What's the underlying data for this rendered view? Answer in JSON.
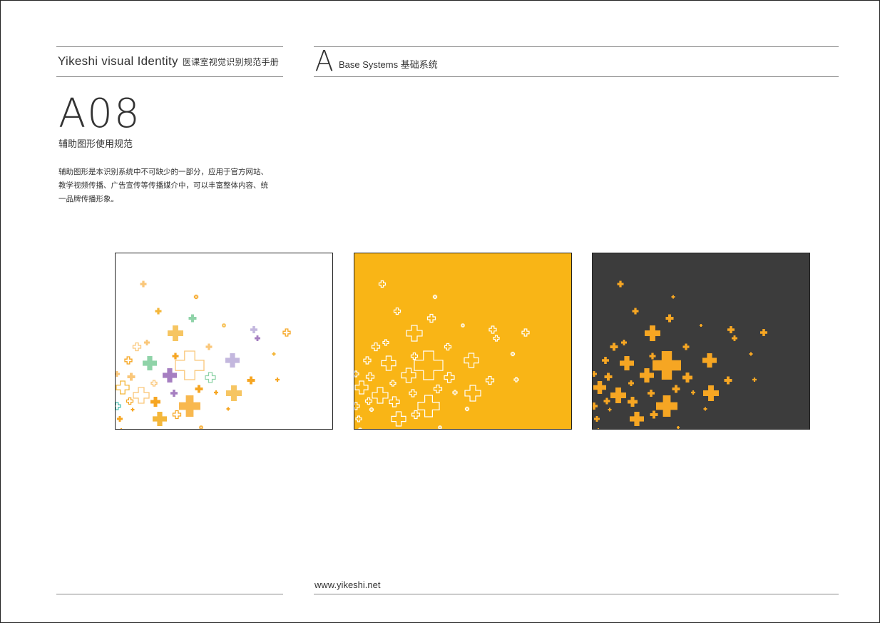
{
  "header": {
    "brand": "Yikeshi visual Identity",
    "brand_sub": "医课室视觉识别规范手册",
    "section_letter": "A",
    "section_title": "Base Systems 基础系统"
  },
  "content": {
    "code": "A08",
    "title": "辅助图形使用规范",
    "description": "辅助图形是本识别系统中不可缺少的一部分，应用于官方网站、教学视频传播、广告宣传等传播媒介中，可以丰富整体内容、统一品牌传播形象。"
  },
  "panels": [
    {
      "name": "white-background-sample",
      "background": "#ffffff",
      "border": "#222222",
      "style": "mixed"
    },
    {
      "name": "yellow-background-sample",
      "background": "#f9b516",
      "border": "#222222",
      "style": "outline"
    },
    {
      "name": "dark-background-sample",
      "background": "#3c3c3c",
      "border": "#222222",
      "style": "solid"
    }
  ],
  "colors": {
    "orange": "#f6a623",
    "light_orange": "#fac77a",
    "yellow": "#f4b73b",
    "green": "#8fd3a8",
    "purple": "#a67fc1",
    "lavender": "#c3b7de",
    "teal": "#4fc1b4",
    "white": "#ffffff"
  },
  "footer": {
    "url": "www.yikeshi.net"
  }
}
